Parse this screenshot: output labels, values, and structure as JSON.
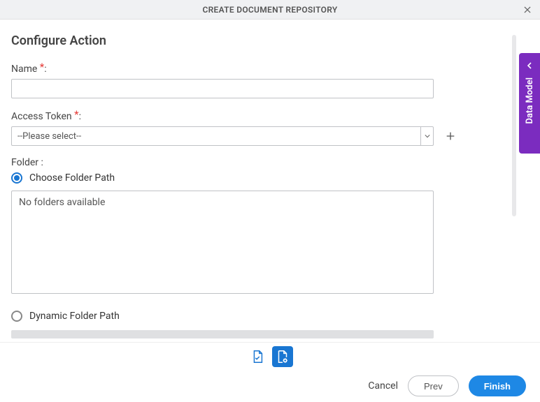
{
  "header": {
    "title": "CREATE DOCUMENT REPOSITORY"
  },
  "section": {
    "title": "Configure Action"
  },
  "fields": {
    "name_label": "Name",
    "name_colon": ":",
    "access_token_label": "Access Token",
    "access_token_colon": ":",
    "access_token_placeholder": "--Please select--",
    "folder_label": "Folder :",
    "choose_folder_label": "Choose Folder Path",
    "folder_empty_text": "No folders available",
    "dynamic_folder_label": "Dynamic Folder Path"
  },
  "footer": {
    "cancel": "Cancel",
    "prev": "Prev",
    "finish": "Finish"
  },
  "side_panel": {
    "label": "Data Model"
  }
}
